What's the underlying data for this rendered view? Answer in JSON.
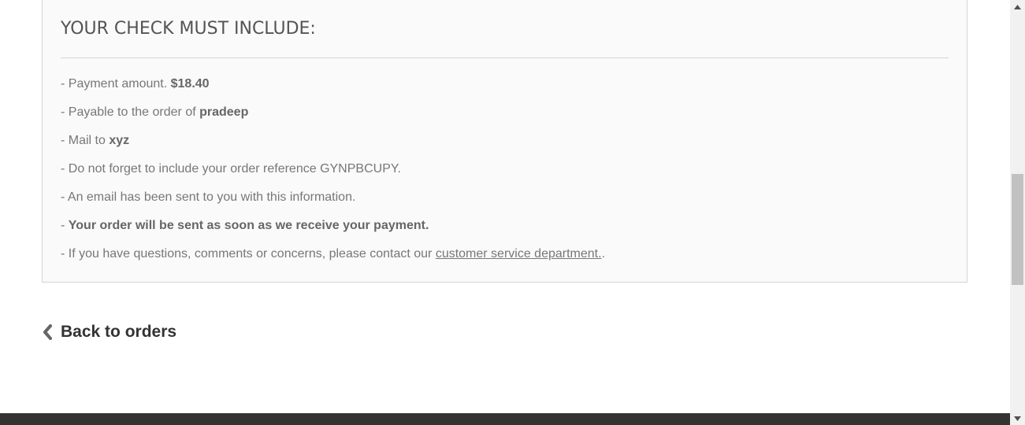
{
  "check_box": {
    "title": "YOUR CHECK MUST INCLUDE:",
    "payment_prefix": "- Payment amount.",
    "payment_amount": "$18.40",
    "payable_prefix": "- Payable to the order of",
    "payable_name": "pradeep",
    "mail_prefix": "- Mail to",
    "mail_address": "xyz",
    "reference_text": "- Do not forget to include your order reference GYNPBCUPY.",
    "email_text": "- An email has been sent to you with this information.",
    "send_prefix": "-",
    "send_text": "Your order will be sent as soon as we receive your payment.",
    "contact_prefix": "- If you have questions, comments or concerns, please contact our",
    "contact_link": "customer service department.",
    "contact_suffix": "."
  },
  "back_link": {
    "label": "Back to orders",
    "icon": "chevron-left-icon"
  },
  "colors": {
    "box_background": "#fafafa",
    "box_border": "#d6d4d4",
    "footer": "#333333",
    "text": "#777777",
    "heading": "#555454"
  }
}
